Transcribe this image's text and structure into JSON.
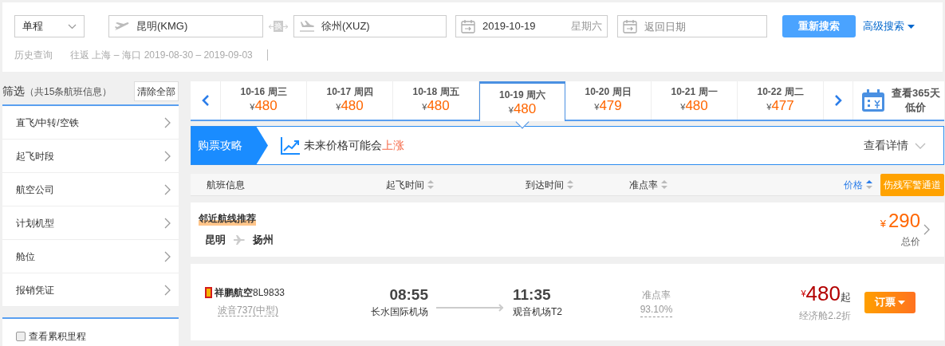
{
  "search": {
    "trip_type": "单程",
    "from": "昆明(KMG)",
    "swap": "换",
    "to": "徐州(XUZ)",
    "date": "2019-10-19",
    "weekday": "星期六",
    "return_placeholder": "返回日期",
    "search_button": "重新搜索",
    "advanced": "高级搜索"
  },
  "history": {
    "label": "历史查询",
    "entries": [
      {
        "route": "往返 上海 – 海口",
        "dates": "2019-08-30 – 2019-09-03"
      }
    ]
  },
  "filter": {
    "title": "筛选",
    "count": "（共15条航班信息）",
    "clear": "清除全部",
    "items": [
      {
        "label": "直飞/中转/空铁"
      },
      {
        "label": "起飞时段"
      },
      {
        "label": "航空公司"
      },
      {
        "label": "计划机型"
      },
      {
        "label": "舱位"
      },
      {
        "label": "报销凭证"
      }
    ],
    "option": {
      "label": "查看累积里程",
      "checked": false
    }
  },
  "date_tabs": [
    {
      "date": "10-16 周三",
      "currency": "¥",
      "price": "480",
      "selected": false
    },
    {
      "date": "10-17 周四",
      "currency": "¥",
      "price": "480",
      "selected": false
    },
    {
      "date": "10-18 周五",
      "currency": "¥",
      "price": "480",
      "selected": false
    },
    {
      "date": "10-19 周六",
      "currency": "¥",
      "price": "480",
      "selected": true
    },
    {
      "date": "10-20 周日",
      "currency": "¥",
      "price": "479",
      "selected": false
    },
    {
      "date": "10-21 周一",
      "currency": "¥",
      "price": "480",
      "selected": false
    },
    {
      "date": "10-22 周二",
      "currency": "¥",
      "price": "477",
      "selected": false
    }
  ],
  "calendar_link": [
    "查看365天",
    "低价"
  ],
  "tip": {
    "tag": "购票攻略",
    "text": "未来价格可能会",
    "highlight": "上涨",
    "details": "查看详情"
  },
  "columns": [
    {
      "label": "航班信息",
      "sortable": false,
      "active": false
    },
    {
      "label": "起飞时间",
      "sortable": true,
      "active": false
    },
    {
      "label": "到达时间",
      "sortable": true,
      "active": false
    },
    {
      "label": "准点率",
      "sortable": true,
      "active": false
    },
    {
      "label": "价格",
      "sortable": true,
      "active": true
    }
  ],
  "special_channel": "伤残军警通道",
  "recommendation": {
    "title": "邻近航线推荐",
    "from": "昆明",
    "to": "扬州",
    "currency": "¥",
    "price": "290",
    "price_label": "总价"
  },
  "flights": [
    {
      "airline": "祥鹏航空",
      "number": "8L9833",
      "aircraft": "波音737(中型)",
      "dep_time": "08:55",
      "dep_airport": "长水国际机场",
      "arr_time": "11:35",
      "arr_airport": "观音机场T2",
      "ontime_label": "准点率",
      "ontime": "93.10%",
      "currency": "¥",
      "price": "480",
      "price_suffix": "起",
      "cabin": "经济舱2.2折",
      "book": "订票"
    }
  ]
}
